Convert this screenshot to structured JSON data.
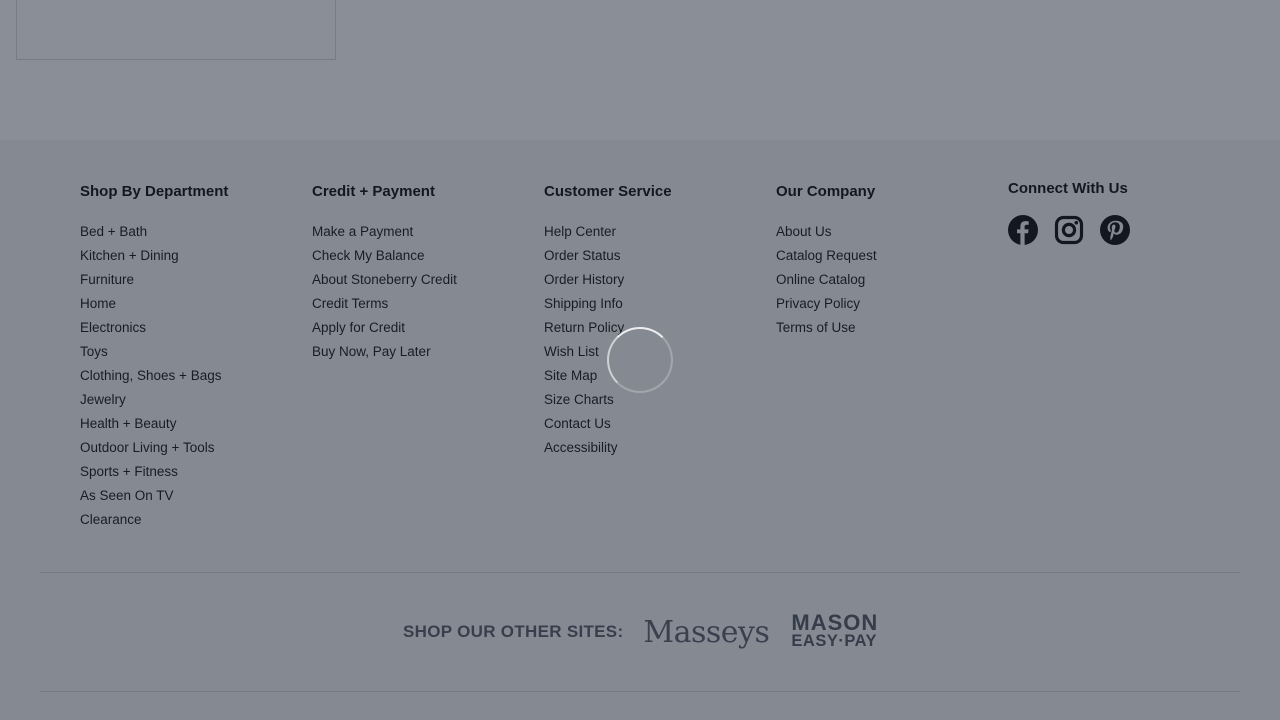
{
  "footer": {
    "columns": [
      {
        "title": "Shop By Department",
        "items": [
          "Bed + Bath",
          "Kitchen + Dining",
          "Furniture",
          "Home",
          "Electronics",
          "Toys",
          "Clothing, Shoes + Bags",
          "Jewelry",
          "Health + Beauty",
          "Outdoor Living + Tools",
          "Sports + Fitness",
          "As Seen On TV",
          "Clearance"
        ]
      },
      {
        "title": "Credit + Payment",
        "items": [
          "Make a Payment",
          "Check My Balance",
          "About Stoneberry Credit",
          "Credit Terms",
          "Apply for Credit",
          "Buy Now, Pay Later"
        ]
      },
      {
        "title": "Customer Service",
        "items": [
          "Help Center",
          "Order Status",
          "Order History",
          "Shipping Info",
          "Return Policy",
          "Wish List",
          "Site Map",
          "Size Charts",
          "Contact Us",
          "Accessibility"
        ]
      },
      {
        "title": "Our Company",
        "items": [
          "About Us",
          "Catalog Request",
          "Online Catalog",
          "Privacy Policy",
          "Terms of Use"
        ]
      }
    ],
    "connect": {
      "title": "Connect With Us",
      "icons": [
        "facebook-icon",
        "instagram-icon",
        "pinterest-icon"
      ]
    },
    "other_sites": {
      "label": "SHOP OUR OTHER SITES:",
      "masseys": "Masseys",
      "mason_line1": "MASON",
      "mason_line2": "EASY·PAY"
    }
  },
  "overlay": {
    "state": "loading",
    "spinner_icon": "loading-spinner-icon"
  },
  "colors": {
    "overlay": "#161e2e",
    "footer_bg": "#f5f5f7",
    "logo_gray": "#5a5f6a"
  }
}
